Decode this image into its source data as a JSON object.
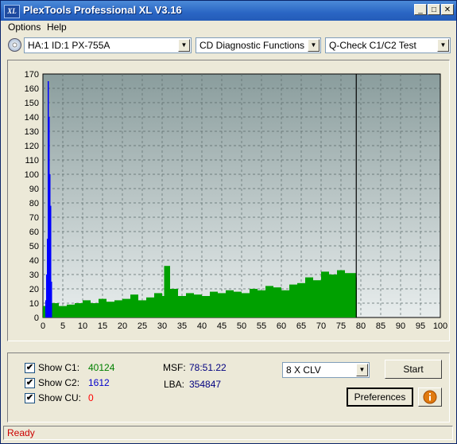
{
  "window": {
    "title": "PlexTools Professional XL V3.16",
    "icon_text": "XL",
    "minimize_glyph": "_",
    "maximize_glyph": "□",
    "close_glyph": "✕"
  },
  "menu": {
    "items": [
      "Options",
      "Help"
    ]
  },
  "toolbar": {
    "drive": "HA:1 ID:1  PX-755A",
    "function": "CD Diagnostic Functions",
    "test": "Q-Check C1/C2 Test",
    "arrow_glyph": "▼"
  },
  "chart_data": {
    "type": "bar",
    "xlim": [
      0,
      100
    ],
    "ylim": [
      0,
      170
    ],
    "x_ticks": [
      0,
      5,
      10,
      15,
      20,
      25,
      30,
      35,
      40,
      45,
      50,
      55,
      60,
      65,
      70,
      75,
      80,
      85,
      90,
      95,
      100
    ],
    "y_ticks": [
      0,
      10,
      20,
      30,
      40,
      50,
      60,
      70,
      80,
      90,
      100,
      110,
      120,
      130,
      140,
      150,
      160,
      170
    ],
    "grid": true,
    "end_marker_x": 78.85,
    "series": [
      {
        "name": "C2",
        "color": "#0000ff",
        "x": [
          0.6,
          0.8,
          1.0,
          1.2,
          1.4,
          1.6,
          1.8,
          2.0
        ],
        "values": [
          12,
          30,
          55,
          165,
          140,
          100,
          78,
          25
        ]
      },
      {
        "name": "C1",
        "color": "#00a000",
        "x": [
          0,
          2,
          4,
          6,
          8,
          10,
          12,
          14,
          16,
          18,
          20,
          22,
          24,
          26,
          28,
          30,
          30.5,
          32,
          34,
          36,
          38,
          40,
          42,
          44,
          46,
          48,
          50,
          52,
          54,
          56,
          58,
          60,
          62,
          64,
          66,
          68,
          70,
          72,
          74,
          76,
          78.8
        ],
        "values": [
          8,
          10,
          8,
          9,
          10,
          12,
          10,
          13,
          11,
          12,
          13,
          16,
          12,
          14,
          17,
          15,
          36,
          20,
          15,
          17,
          16,
          15,
          18,
          17,
          19,
          18,
          17,
          20,
          19,
          22,
          21,
          19,
          23,
          24,
          28,
          26,
          32,
          30,
          33,
          31,
          28
        ]
      }
    ],
    "background_gradient": [
      "#8a9d9d",
      "#e8eded"
    ]
  },
  "stats": {
    "show_c1_label": "Show C1:",
    "show_c2_label": "Show C2:",
    "show_cu_label": "Show CU:",
    "c1_value": "40124",
    "c2_value": "1612",
    "cu_value": "0",
    "c1_checked": true,
    "c2_checked": true,
    "cu_checked": true,
    "check_glyph": "✔",
    "msf_label": "MSF:",
    "msf_value": "78:51.22",
    "lba_label": "LBA:",
    "lba_value": "354847"
  },
  "controls": {
    "speed": "8 X CLV",
    "start_label": "Start",
    "preferences_label": "Preferences",
    "info_icon": "info-icon"
  },
  "status": {
    "text": "Ready"
  },
  "colors": {
    "c1": "#00a000",
    "c2": "#0000ff",
    "cu": "#ff0000",
    "status_text": "#cc0000",
    "value_blue": "#000080"
  }
}
